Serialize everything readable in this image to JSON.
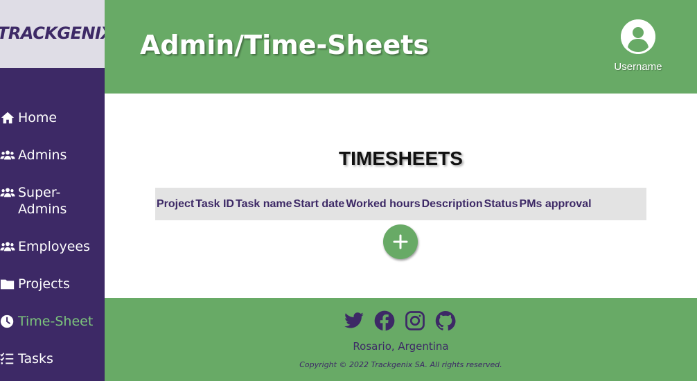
{
  "brand": {
    "logo_text": "TRACKGENIX"
  },
  "sidebar": {
    "items": [
      {
        "label": "Home",
        "icon": "home-icon",
        "active": false
      },
      {
        "label": "Admins",
        "icon": "users-icon",
        "active": false
      },
      {
        "label": "Super-Admins",
        "icon": "users-icon",
        "active": false
      },
      {
        "label": "Employees",
        "icon": "users-icon",
        "active": false
      },
      {
        "label": "Projects",
        "icon": "folder-icon",
        "active": false
      },
      {
        "label": "Time-Sheet",
        "icon": "clock-icon",
        "active": true
      },
      {
        "label": "Tasks",
        "icon": "tasks-list-icon",
        "active": false
      }
    ]
  },
  "header": {
    "title": "Admin/Time-Sheets",
    "user": {
      "name": "Username",
      "icon": "user-circle-icon"
    }
  },
  "main": {
    "title": "TIMESHEETS",
    "table": {
      "columns": [
        "Project",
        "Task ID",
        "Task name",
        "Start date",
        "Worked hours",
        "Description",
        "Status",
        "PMs approval"
      ],
      "rows": []
    },
    "add_button": {
      "icon": "plus-icon"
    }
  },
  "footer": {
    "socials": [
      "twitter-icon",
      "facebook-icon",
      "instagram-icon",
      "github-icon"
    ],
    "location": "Rosario, Argentina",
    "copyright": "Copyright © 2022 Trackgenix SA. All rights reserved."
  },
  "colors": {
    "sidebar_bg": "#3d2966",
    "accent_green": "#68aa66",
    "active_link": "#7cc47c",
    "logo_bg": "#dfdde6",
    "table_header_bg": "#e3e3e3"
  }
}
